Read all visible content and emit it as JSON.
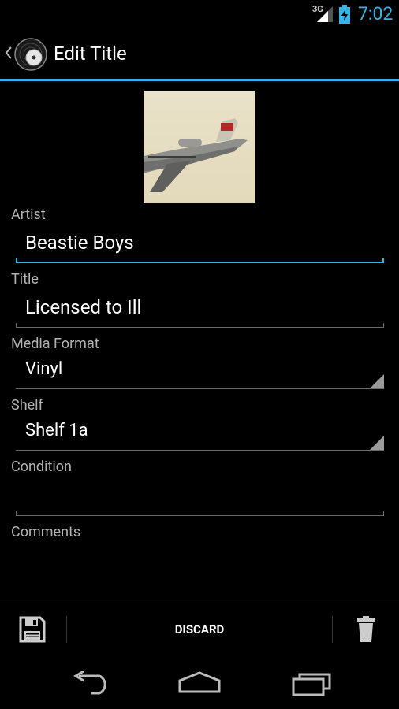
{
  "status_bar": {
    "network": "3G",
    "time": "7:02"
  },
  "action_bar": {
    "title": "Edit Title"
  },
  "form": {
    "artist_label": "Artist",
    "artist_value": "Beastie Boys",
    "title_label": "Title",
    "title_value": "Licensed to Ill",
    "media_format_label": "Media Format",
    "media_format_value": "Vinyl",
    "shelf_label": "Shelf",
    "shelf_value": "Shelf 1a",
    "condition_label": "Condition",
    "condition_value": "",
    "comments_label": "Comments"
  },
  "bottom_bar": {
    "save_icon": "save-icon",
    "discard_label": "DISCARD",
    "delete_icon": "trash-icon"
  },
  "colors": {
    "accent": "#33b5e5",
    "background": "#000000",
    "label": "#b4b4b4"
  }
}
